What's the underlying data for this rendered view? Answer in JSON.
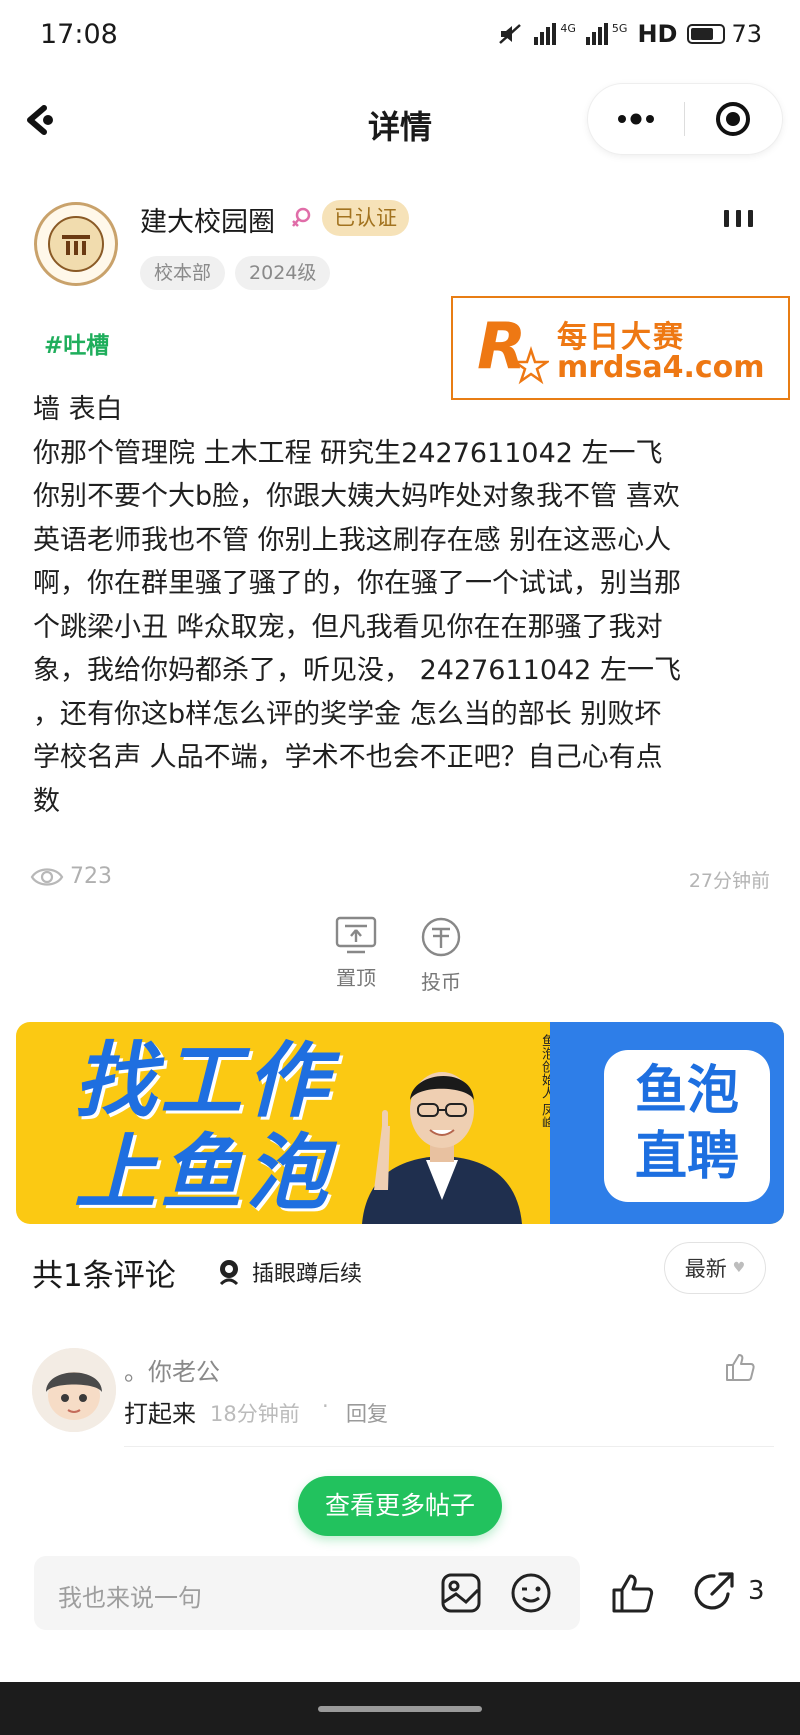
{
  "status_bar": {
    "time": "17:08",
    "signal_1_label": "4G",
    "signal_2_label": "5G",
    "hd_label": "HD",
    "battery": "73"
  },
  "nav": {
    "title": "详情"
  },
  "author": {
    "name": "建大校园圈",
    "verified": "已认证",
    "tags": [
      "校本部",
      "2024级"
    ]
  },
  "watermark": {
    "line1": "每日大赛",
    "line2": "mrdsa4.com"
  },
  "post": {
    "topic": "#吐槽",
    "lines": [
      "墙 表白",
      "你那个管理院 土木工程 研究生2427611042 左一飞",
      "你别不要个大b脸，你跟大姨大妈咋处对象我不管 喜欢",
      "英语老师我也不管 你别上我这刷存在感 别在这恶心人",
      "啊，你在群里骚了骚了的，你在骚了一个试试，别当那",
      "个跳梁小丑 哗众取宠，但凡我看见你在在那骚了我对",
      "象，我给你妈都杀了，听见没， 2427611042 左一飞",
      "，还有你这b样怎么评的奖学金 怎么当的部长 别败坏",
      "学校名声 人品不端，学术不也会不正吧？自己心有点",
      "数"
    ],
    "views": "723",
    "time_ago": "27分钟前"
  },
  "actions": {
    "pin": "置顶",
    "coin": "投币"
  },
  "banner": {
    "slogan_line1": "找工作",
    "slogan_line2": "上鱼泡",
    "app_line1": "鱼泡",
    "app_line2": "直聘",
    "founder_note": "鱼泡创始人 凤峰"
  },
  "comments": {
    "count_label": "共1条评论",
    "follow_hint": "插眼蹲后续",
    "sort_label": "最新",
    "items": [
      {
        "name": "。你老公",
        "text": "打起来",
        "time": "18分钟前",
        "separator": "·",
        "reply": "回复"
      }
    ]
  },
  "more_posts": "查看更多帖子",
  "input": {
    "placeholder": "我也来说一句"
  },
  "share_count": "3",
  "colors": {
    "accent_green": "#22c25e",
    "topic_green": "#1fae5c",
    "verified_bg": "#f6e2b8",
    "banner_yellow": "#fbc913",
    "banner_blue": "#2e7ee8",
    "watermark_orange": "#ee7813"
  },
  "icons": {
    "back": "back-arrow-icon",
    "more": "more-dots-icon",
    "target": "target-icon",
    "gender": "female-icon",
    "menu": "menu-bars-icon",
    "views": "eye-icon",
    "pin": "pin-top-icon",
    "coin": "coin-icon",
    "follow": "eye-watch-icon",
    "like": "thumbs-up-icon",
    "image": "image-icon",
    "emoji": "emoji-icon",
    "share": "share-icon"
  }
}
